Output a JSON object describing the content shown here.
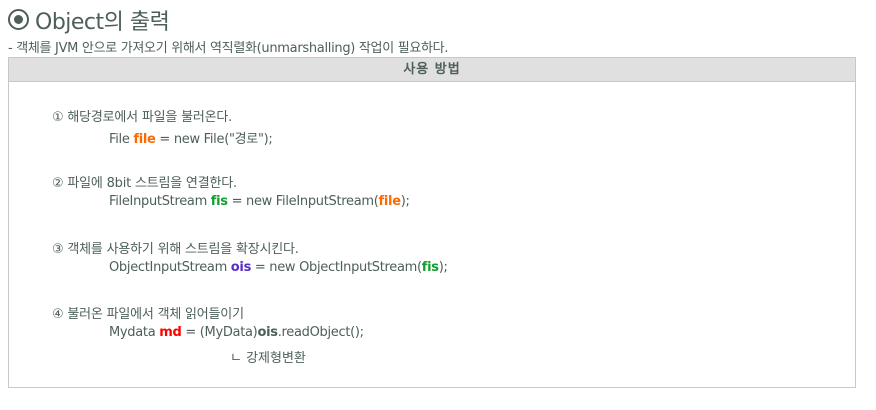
{
  "title": "Object의 출력",
  "description": "- 객체를 JVM 안으로 가져오기 위해서 역직렬화(unmarshalling) 작업이 필요하다.",
  "box_header": "사용 방법",
  "steps": [
    {
      "label": "① 해당경로에서 파일을 불러온다.",
      "code": [
        "File ",
        "file",
        " = new File(\"경로\");"
      ]
    },
    {
      "label": "② 파일에 8bit 스트림을 연결한다.",
      "code": [
        "FileInputStream ",
        "fis",
        " = new FileInputStream(",
        "file",
        ");"
      ]
    },
    {
      "label": "③ 객체를 사용하기 위해 스트림을 확장시킨다.",
      "code": [
        "ObjectInputStream ",
        "ois",
        " = new ObjectInputStream(",
        "fis",
        ");"
      ]
    },
    {
      "label": "④ 불러온 파일에서 객체 읽어들이기",
      "code": [
        "Mydata ",
        "md",
        " = (MyData)",
        "ois",
        ".readObject();"
      ]
    }
  ],
  "note": "ㄴ 강제형변환",
  "colors": {
    "text": "#4d5f58",
    "orange": "#ff6a00",
    "green": "#10a030",
    "purple": "#5a2ec8",
    "red": "#ff0000"
  }
}
